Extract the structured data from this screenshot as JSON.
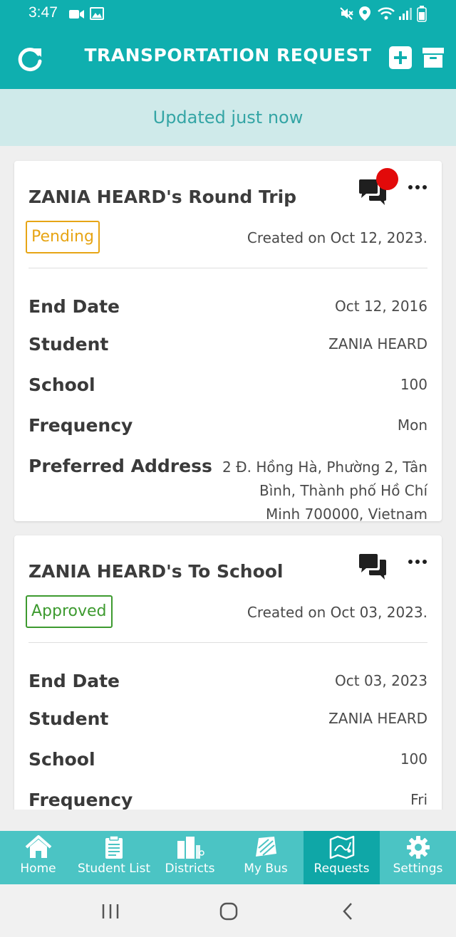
{
  "status_bar": {
    "time": "3:47"
  },
  "header": {
    "title": "TRANSPORTATION REQUEST"
  },
  "banner": {
    "text": "Updated just now"
  },
  "requests": [
    {
      "title": "ZANIA HEARD's Round Trip",
      "status": "Pending",
      "created": "Created on Oct 12, 2023.",
      "has_new_message": true,
      "fields": [
        {
          "label": "End Date",
          "value": "Oct 12, 2016"
        },
        {
          "label": "Student",
          "value": "ZANIA HEARD"
        },
        {
          "label": "School",
          "value": "100"
        },
        {
          "label": "Frequency",
          "value": "Mon"
        },
        {
          "label": "Preferred Address",
          "value": "2 Đ. Hồng Hà, Phường 2, Tân Bình, Thành phố Hồ Chí Minh 700000, Vietnam"
        }
      ]
    },
    {
      "title": "ZANIA HEARD's To School",
      "status": "Approved",
      "created": "Created on Oct 03, 2023.",
      "has_new_message": false,
      "fields": [
        {
          "label": "End Date",
          "value": "Oct 03, 2023"
        },
        {
          "label": "Student",
          "value": "ZANIA HEARD"
        },
        {
          "label": "School",
          "value": "100"
        },
        {
          "label": "Frequency",
          "value": "Fri"
        }
      ]
    }
  ],
  "bottom_nav": [
    {
      "label": "Home",
      "icon": "home-icon"
    },
    {
      "label": "Student List",
      "icon": "clipboard-icon"
    },
    {
      "label": "Districts",
      "icon": "buildings-icon"
    },
    {
      "label": "My Bus",
      "icon": "bus-icon"
    },
    {
      "label": "Requests",
      "icon": "map-icon",
      "active": true
    },
    {
      "label": "Settings",
      "icon": "gear-icon"
    }
  ],
  "colors": {
    "primary": "#0fafaf",
    "nav": "#4bc4c4",
    "nav_active": "#0fa7a7",
    "banner_bg": "#cfeaea",
    "pending": "#e7a515",
    "approved": "#3d9a2f",
    "notification": "#e20a0a"
  }
}
